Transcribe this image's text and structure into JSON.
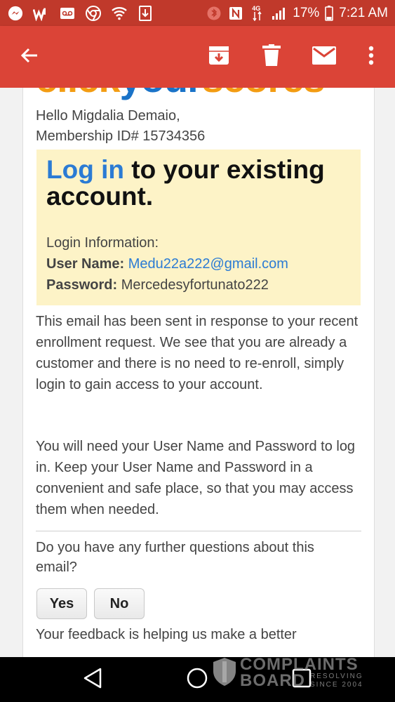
{
  "status_bar": {
    "left_icons": [
      "messenger-icon",
      "w-app-icon",
      "voicemail-icon",
      "chrome-icon",
      "wifi-icon",
      "download-icon"
    ],
    "right_icons": [
      "bluetooth-icon",
      "nfc-icon",
      "data-4g-icon",
      "signal-icon",
      "battery-icon"
    ],
    "network": "4G",
    "battery": "17%",
    "time": "7:21 AM",
    "background": "#c0392b"
  },
  "app_bar": {
    "background": "#db4437",
    "actions": [
      "back-arrow-icon",
      "archive-icon",
      "delete-icon",
      "mark-unread-icon",
      "more-vert-icon"
    ]
  },
  "email": {
    "logo": {
      "part1": "click",
      "part2": "your",
      "part3": "scores"
    },
    "greeting": {
      "line1": "Hello Migdalia Demaio,",
      "line2": "Membership ID# 15734356"
    },
    "login_box": {
      "title_link": "Log in",
      "title_rest": " to your existing account.",
      "info_heading": "Login Information:",
      "username_label": "User Name:",
      "username_value": "Medu22a222@gmail.com",
      "password_label": "Password:",
      "password_value": "Mercedesyfortunato222",
      "background": "#fdf3c7"
    },
    "paragraph1": "This email has been sent in response to your recent enrollment request. We see that you are already a customer and there is no need to re-enroll, simply login to gain access to your account.",
    "paragraph2": "You will need your User Name and Password to log in. Keep your User Name and Password in a convenient and safe place, so that you may access them when needed.",
    "question": "Do you have any further questions about this email?",
    "yes_label": "Yes",
    "no_label": "No",
    "feedback": "Your feedback is helping us make a better"
  },
  "nav_bar": {
    "buttons": [
      "back-triangle-icon",
      "home-circle-icon",
      "recents-square-icon"
    ]
  },
  "watermark": {
    "line1": "COMPLAINTS",
    "line2": "BOARD",
    "line3": "RESOLVING",
    "line4": "SINCE 2004"
  }
}
